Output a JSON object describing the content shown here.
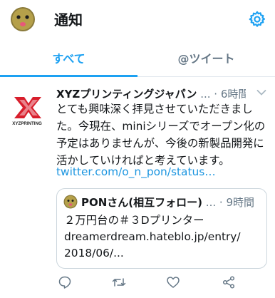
{
  "header": {
    "title": "通知",
    "avatar_icon": "smiley-face-avatar-icon",
    "settings_icon": "gear-icon"
  },
  "tabs": [
    {
      "label": "すべて",
      "active": true
    },
    {
      "label": "@ツイート",
      "active": false
    }
  ],
  "notification": {
    "account_logo_text": "XYZPRINTING",
    "name": "XYZプリンティングジャパン",
    "handle_ellipsis": "...",
    "time": "6時間",
    "text": "とても興味深く拝見させていただきました。今現在、miniシリーズでオープン化の予定はありませんが、今後の新製品開発に活かしていければと考えています。",
    "link": "twitter.com/o_n_pon/status…",
    "quoted": {
      "name": "PONさん(相互フォロー)",
      "handle_ellipsis": "...",
      "time": "9時間",
      "text": "２万円台の＃３Dプリンター dreamerdream.hateblo.jp/entry/ 2018/06/..."
    },
    "actions": [
      "reply-icon",
      "retweet-icon",
      "like-icon",
      "share-icon"
    ]
  },
  "colors": {
    "accent": "#1da1f2",
    "link": "#1b95e0",
    "secondary": "#657786",
    "logo_red": "#d81e2c"
  }
}
